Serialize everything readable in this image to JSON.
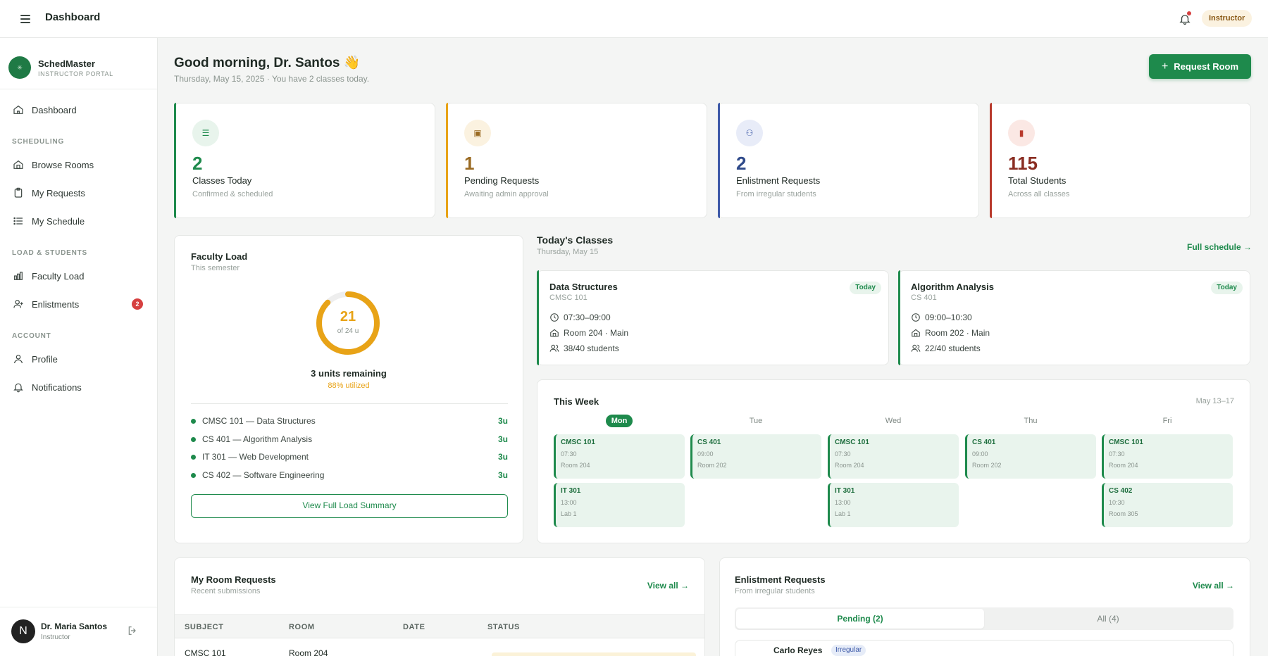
{
  "topbar": {
    "title": "Dashboard",
    "role": "Instructor"
  },
  "brand": {
    "name": "SchedMaster",
    "sub": "INSTRUCTOR PORTAL"
  },
  "nav": {
    "dashboard": "Dashboard",
    "section_scheduling": "SCHEDULING",
    "browse_rooms": "Browse Rooms",
    "my_requests": "My Requests",
    "my_schedule": "My Schedule",
    "section_load": "LOAD & STUDENTS",
    "faculty_load": "Faculty Load",
    "enlistments": "Enlistments",
    "enlistments_badge": "2",
    "section_account": "ACCOUNT",
    "profile": "Profile",
    "notifications": "Notifications"
  },
  "user": {
    "initial": "N",
    "name": "Dr. Maria Santos",
    "role": "Instructor"
  },
  "header": {
    "greeting": "Good morning, Dr. Santos 👋",
    "subtitle": "Thursday, May 15, 2025 · You have 2 classes today.",
    "request_button": "Request Room"
  },
  "stats": [
    {
      "value": "2",
      "label": "Classes Today",
      "sub": "Confirmed & scheduled",
      "color": "#1e8a4c",
      "icon": "list-icon"
    },
    {
      "value": "1",
      "label": "Pending Requests",
      "sub": "Awaiting admin approval",
      "color": "#9a6a22",
      "icon": "clipboard-icon"
    },
    {
      "value": "2",
      "label": "Enlistment Requests",
      "sub": "From irregular students",
      "color": "#2f4a8a",
      "icon": "users-icon"
    },
    {
      "value": "115",
      "label": "Total Students",
      "sub": "Across all classes",
      "color": "#8a2d22",
      "icon": "bar-chart-icon"
    }
  ],
  "faculty_load": {
    "title": "Faculty Load",
    "sub": "This semester",
    "value": "21",
    "of": "of 24 u",
    "fraction": 0.875,
    "remaining": "3 units remaining",
    "utilized": "88% utilized",
    "courses": [
      {
        "name": "CMSC 101 — Data Structures",
        "units": "3u"
      },
      {
        "name": "CS 401 — Algorithm Analysis",
        "units": "3u"
      },
      {
        "name": "IT 301 — Web Development",
        "units": "3u"
      },
      {
        "name": "CS 402 — Software Engineering",
        "units": "3u"
      }
    ],
    "button": "View Full Load Summary"
  },
  "today": {
    "title": "Today's Classes",
    "sub": "Thursday, May 15",
    "link": "Full schedule →",
    "classes": [
      {
        "name": "Data Structures",
        "code": "CMSC 101",
        "badge": "Today",
        "time": "07:30–09:00",
        "room": "Room 204 · Main",
        "students": "38/40 students"
      },
      {
        "name": "Algorithm Analysis",
        "code": "CS 401",
        "badge": "Today",
        "time": "09:00–10:30",
        "room": "Room 202 · Main",
        "students": "22/40 students"
      }
    ]
  },
  "week": {
    "title": "This Week",
    "range": "May 13–17",
    "days": [
      "Mon",
      "Tue",
      "Wed",
      "Thu",
      "Fri"
    ],
    "slots": [
      {
        "code": "CMSC 101",
        "time": "07:30",
        "room": "Room 204"
      },
      {
        "code": "CS 401",
        "time": "09:00",
        "room": "Room 202"
      },
      {
        "code": "CMSC 101",
        "time": "07:30",
        "room": "Room 204"
      },
      {
        "code": "CS 401",
        "time": "09:00",
        "room": "Room 202"
      },
      {
        "code": "CMSC 101",
        "time": "07:30",
        "room": "Room 204"
      },
      {
        "code": "IT 301",
        "time": "13:00",
        "room": "Lab 1"
      },
      {
        "code": "IT 301",
        "time": "13:00",
        "room": "Lab 1"
      },
      {
        "code": "CS 402",
        "time": "10:30",
        "room": "Room 305"
      }
    ]
  },
  "room_requests": {
    "title": "My Room Requests",
    "sub": "Recent submissions",
    "link": "View all →",
    "columns": [
      "SUBJECT",
      "ROOM",
      "DATE",
      "STATUS"
    ],
    "rows": [
      {
        "subject": "CMSC 101",
        "room": "Room 204"
      }
    ]
  },
  "enlistment_requests": {
    "title": "Enlistment Requests",
    "sub": "From irregular students",
    "link": "View all →",
    "tab_pending": "Pending (2)",
    "tab_all": "All (4)",
    "first_name": "Carlo Reyes",
    "first_tag": "Irregular"
  }
}
